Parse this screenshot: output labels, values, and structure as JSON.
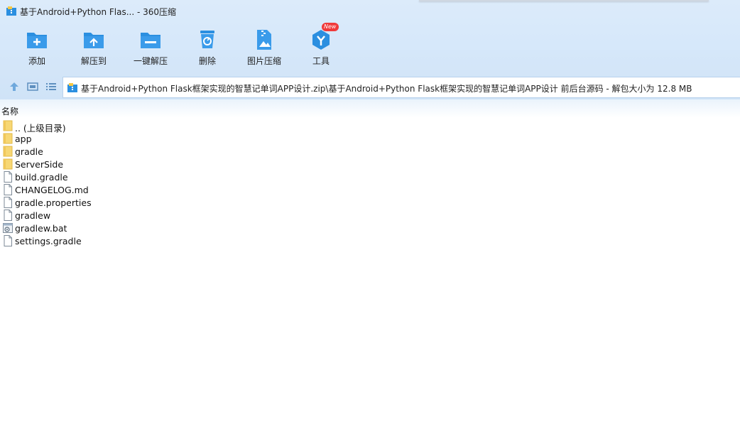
{
  "window": {
    "title": "基于Android+Python Flas... - 360压缩"
  },
  "toolbar": {
    "items": [
      {
        "label": "添加",
        "icon": "add-folder-icon"
      },
      {
        "label": "解压到",
        "icon": "extract-to-icon"
      },
      {
        "label": "一键解压",
        "icon": "one-click-extract-icon"
      },
      {
        "label": "删除",
        "icon": "delete-trash-icon"
      },
      {
        "label": "图片压缩",
        "icon": "image-compress-icon"
      },
      {
        "label": "工具",
        "icon": "tools-icon",
        "badge": "New"
      }
    ]
  },
  "address": {
    "path": "基于Android+Python Flask框架实现的智慧记单词APP设计.zip\\基于Android+Python Flask框架实现的智慧记单词APP设计 前后台源码 - 解包大小为 12.8 MB"
  },
  "list": {
    "column_name": "名称",
    "items": [
      {
        "name": ".. (上级目录)",
        "type": "folder"
      },
      {
        "name": "app",
        "type": "folder"
      },
      {
        "name": "gradle",
        "type": "folder"
      },
      {
        "name": "ServerSide",
        "type": "folder"
      },
      {
        "name": "build.gradle",
        "type": "file"
      },
      {
        "name": "CHANGELOG.md",
        "type": "file"
      },
      {
        "name": "gradle.properties",
        "type": "file"
      },
      {
        "name": "gradlew",
        "type": "file"
      },
      {
        "name": "gradlew.bat",
        "type": "bat"
      },
      {
        "name": "settings.gradle",
        "type": "file"
      }
    ]
  },
  "colors": {
    "accent": "#2b8fe0",
    "folder": "#f7d774",
    "badge": "#f03a3a"
  }
}
